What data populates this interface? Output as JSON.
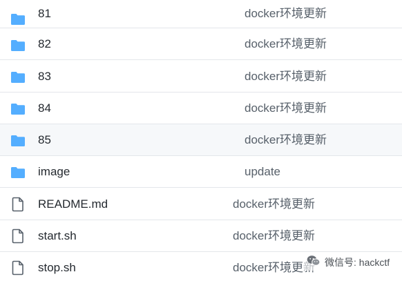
{
  "colors": {
    "folder": "#54aeff",
    "file_icon": "#57606a",
    "row_border": "#e3e6ea",
    "row_hover": "#f6f8fa",
    "name_text": "#24292f",
    "message_text": "#57606a"
  },
  "rows": [
    {
      "type": "dir",
      "icon": "folder-icon",
      "name": "81",
      "message": "docker环境更新"
    },
    {
      "type": "dir",
      "icon": "folder-icon",
      "name": "82",
      "message": "docker环境更新"
    },
    {
      "type": "dir",
      "icon": "folder-icon",
      "name": "83",
      "message": "docker环境更新"
    },
    {
      "type": "dir",
      "icon": "folder-icon",
      "name": "84",
      "message": "docker环境更新"
    },
    {
      "type": "dir",
      "icon": "folder-icon",
      "name": "85",
      "message": "docker环境更新",
      "hovered": true
    },
    {
      "type": "dir",
      "icon": "folder-icon",
      "name": "image",
      "message": "update"
    },
    {
      "type": "file",
      "icon": "file-icon",
      "name": "README.md",
      "message": "docker环境更新"
    },
    {
      "type": "file",
      "icon": "file-icon",
      "name": "start.sh",
      "message": "docker环境更新"
    },
    {
      "type": "file",
      "icon": "file-icon",
      "name": "stop.sh",
      "message": "docker环境更新"
    }
  ],
  "watermark": {
    "icon": "wechat-icon",
    "text": "微信号: hackctf"
  }
}
